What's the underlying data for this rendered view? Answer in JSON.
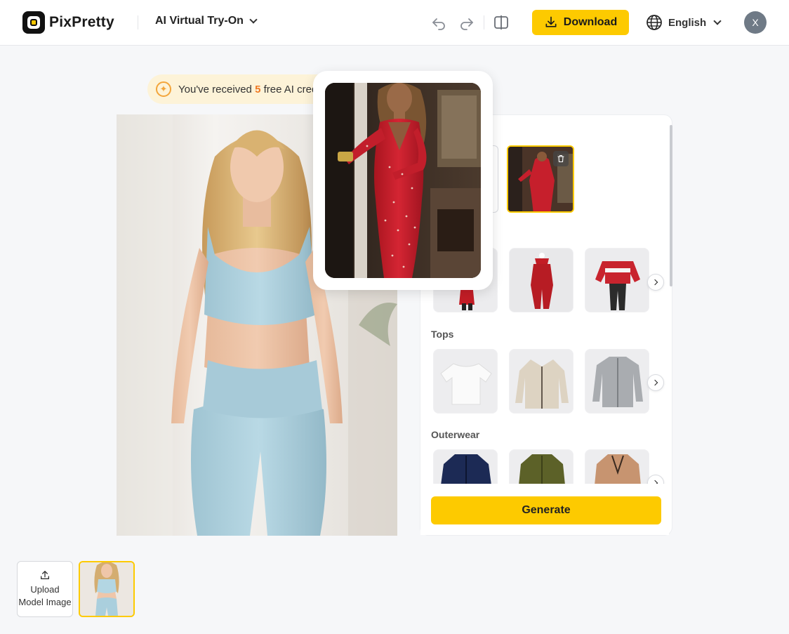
{
  "header": {
    "brand": "PixPretty",
    "tool_name": "AI Virtual Try-On",
    "download_label": "Download",
    "language": "English",
    "avatar_initial": "X"
  },
  "banner": {
    "prefix": "You've received ",
    "count": "5",
    "suffix": " free AI credits"
  },
  "panel": {
    "partial_text": "e",
    "sections": [
      {
        "title": "Tops"
      },
      {
        "title": "Outerwear"
      }
    ],
    "generate_label": "Generate"
  },
  "bottom": {
    "upload_label_line1": "Upload",
    "upload_label_line2": "Model Image"
  },
  "colors": {
    "accent": "#fdca00",
    "banner_bg": "#fdf3d8",
    "credit_count": "#f07a23",
    "avatar": "#6f7a86"
  },
  "icons": [
    "undo-icon",
    "redo-icon",
    "compare-icon",
    "download-icon",
    "globe-icon",
    "chevron-down-icon",
    "sparkle-icon",
    "trash-icon",
    "chevron-right-icon",
    "upload-icon"
  ]
}
